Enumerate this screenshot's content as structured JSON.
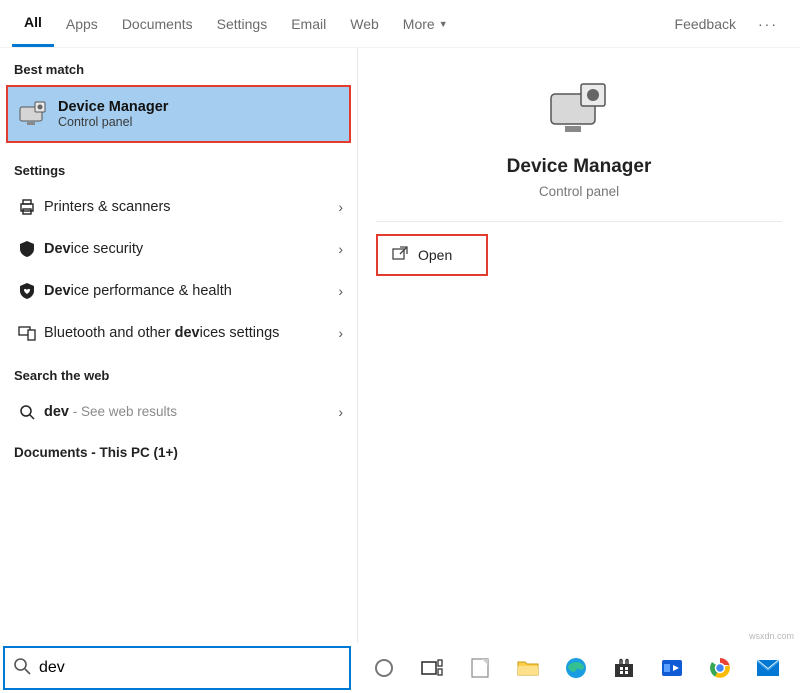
{
  "tabs": {
    "all": "All",
    "apps": "Apps",
    "documents": "Documents",
    "settings": "Settings",
    "email": "Email",
    "web": "Web",
    "more": "More",
    "feedback": "Feedback"
  },
  "sections": {
    "best_match": "Best match",
    "settings": "Settings",
    "search_web": "Search the web",
    "documents": "Documents - This PC (1+)"
  },
  "best_match": {
    "title": "Device Manager",
    "subtitle": "Control panel"
  },
  "settings_rows": {
    "printers": {
      "pre": "Printers & scanners"
    },
    "security": {
      "pre": "Dev",
      "post": "ice security"
    },
    "perf": {
      "pre": "Dev",
      "post": "ice performance & health"
    },
    "bt": {
      "pre": "Bluetooth and other ",
      "mid": "dev",
      "post": "ices settings"
    }
  },
  "web_row": {
    "term": "dev",
    "suffix": " - See web results"
  },
  "preview": {
    "title": "Device Manager",
    "subtitle": "Control panel",
    "open": "Open"
  },
  "search": {
    "value": "dev"
  },
  "watermark": "wsxdn.com"
}
